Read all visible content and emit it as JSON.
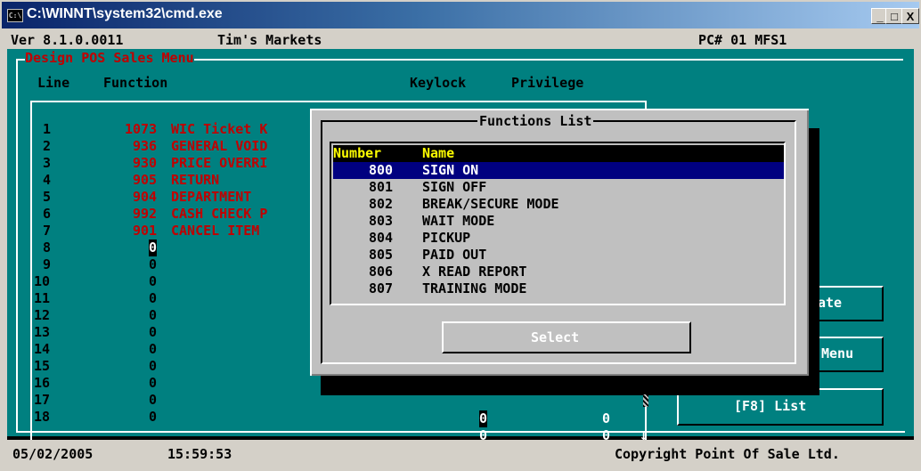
{
  "window": {
    "title": "C:\\WINNT\\system32\\cmd.exe",
    "icon": "cmd-icon",
    "minimize": "_",
    "maximize": "□",
    "close": "X"
  },
  "header": {
    "version": "Ver 8.1.0.0011",
    "store": "Tim's Markets",
    "pc": "PC# 01 MFS1"
  },
  "screen": {
    "title": "Design POS Sales Menu",
    "col_line": "Line",
    "col_function": "Function",
    "col_keylock": "Keylock",
    "col_privilege": "Privilege"
  },
  "lines": [
    {
      "n": "1",
      "code": "1073",
      "name": "WIC Ticket K"
    },
    {
      "n": "2",
      "code": "936",
      "name": "GENERAL VOID"
    },
    {
      "n": "3",
      "code": "930",
      "name": "PRICE OVERRI"
    },
    {
      "n": "4",
      "code": "905",
      "name": "RETURN"
    },
    {
      "n": "5",
      "code": "904",
      "name": "DEPARTMENT"
    },
    {
      "n": "6",
      "code": "992",
      "name": "CASH CHECK P"
    },
    {
      "n": "7",
      "code": "901",
      "name": "CANCEL ITEM"
    },
    {
      "n": "8",
      "code": "0",
      "name": ""
    },
    {
      "n": "9",
      "code": "0",
      "name": ""
    },
    {
      "n": "10",
      "code": "0",
      "name": ""
    },
    {
      "n": "11",
      "code": "0",
      "name": ""
    },
    {
      "n": "12",
      "code": "0",
      "name": ""
    },
    {
      "n": "13",
      "code": "0",
      "name": ""
    },
    {
      "n": "14",
      "code": "0",
      "name": ""
    },
    {
      "n": "15",
      "code": "0",
      "name": ""
    },
    {
      "n": "16",
      "code": "0",
      "name": ""
    },
    {
      "n": "17",
      "code": "0",
      "name": ""
    },
    {
      "n": "18",
      "code": "0",
      "name": ""
    }
  ],
  "row17": {
    "keylock": "0",
    "privilege": "0"
  },
  "row18": {
    "keylock": "0",
    "privilege": "0"
  },
  "scroll_arrow": "↓",
  "side_buttons": {
    "update": "ate",
    "menu": "Menu",
    "list": "[F8] List"
  },
  "dialog": {
    "title": "Functions List",
    "col_number": "Number",
    "col_name": "Name",
    "items": [
      {
        "number": "800",
        "name": "SIGN ON"
      },
      {
        "number": "801",
        "name": "SIGN OFF"
      },
      {
        "number": "802",
        "name": "BREAK/SECURE MODE"
      },
      {
        "number": "803",
        "name": "WAIT MODE"
      },
      {
        "number": "804",
        "name": "PICKUP"
      },
      {
        "number": "805",
        "name": "PAID OUT"
      },
      {
        "number": "806",
        "name": "X READ REPORT"
      },
      {
        "number": "807",
        "name": "TRAINING MODE"
      }
    ],
    "selected_index": 0,
    "select_label": "Select"
  },
  "footer": {
    "date": "05/02/2005",
    "time": "15:59:53",
    "copyright": "Copyright Point Of Sale Ltd."
  },
  "colors": {
    "teal": "#008080",
    "yellow": "#ffff00",
    "red": "#c00000",
    "selection": "#000080"
  }
}
